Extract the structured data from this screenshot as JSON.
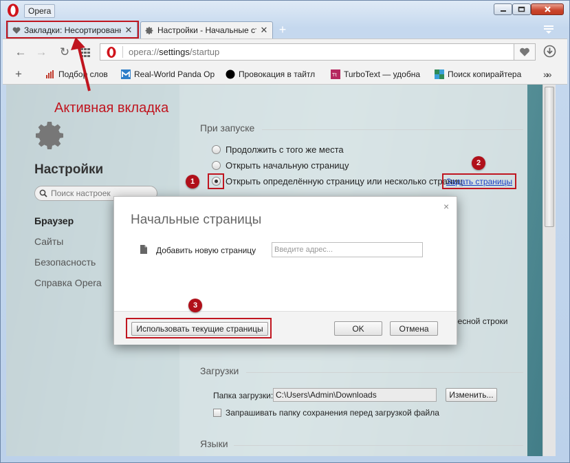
{
  "window": {
    "app_title": "Opera",
    "minimize_glyph": "—",
    "close_glyph": "✕"
  },
  "tabs": [
    {
      "label": "Закладки: Несортированные закладки",
      "icon": "heart-icon",
      "close": "✕"
    },
    {
      "label": "Настройки - Начальные страницы",
      "icon": "gear-icon",
      "close": "✕"
    }
  ],
  "new_tab_glyph": "+",
  "toolbar": {
    "back_glyph": "←",
    "forward_glyph": "→",
    "reload_glyph": "↻",
    "url_scheme": "opera://",
    "url_host": "settings",
    "url_path": "/startup"
  },
  "bookmarks_bar": {
    "add_glyph": "+",
    "more_glyph": "»»",
    "items": [
      {
        "label": "Подбор слов",
        "icon": "bar-chart-icon",
        "color": "#c0392b"
      },
      {
        "label": "Real-World Panda Op",
        "icon": "m-logo-icon",
        "color": "#2d7ec9"
      },
      {
        "label": "Провокация в тайтл",
        "icon": "black-circle-icon",
        "color": "#000000"
      },
      {
        "label": "TurboText — удобна",
        "icon": "tt-logo-icon",
        "color": "#b5275f"
      },
      {
        "label": "Поиск копирайтера",
        "icon": "grid-logo-icon",
        "color": "#2e8b57"
      }
    ]
  },
  "sidebar": {
    "title": "Настройки",
    "search_placeholder": "Поиск настроек",
    "items": [
      {
        "label": "Браузер",
        "active": true
      },
      {
        "label": "Сайты",
        "active": false
      },
      {
        "label": "Безопасность",
        "active": false
      },
      {
        "label": "Справка Opera",
        "active": false
      }
    ]
  },
  "startup": {
    "section_title": "При запуске",
    "options": [
      {
        "label": "Продолжить с того же места",
        "checked": false
      },
      {
        "label": "Открыть начальную страницу",
        "checked": false
      },
      {
        "label": "Открыть определённую страницу или несколько страниц",
        "checked": true
      }
    ],
    "set_pages_link": "Задать страницы",
    "address_bar_fragment": "дресной строки"
  },
  "downloads": {
    "section_title": "Загрузки",
    "folder_label": "Папка загрузки:",
    "folder_value": "C:\\Users\\Admin\\Downloads",
    "change_button": "Изменить...",
    "ask_label": "Запрашивать папку сохранения перед загрузкой файла"
  },
  "languages": {
    "section_title": "Языки"
  },
  "modal": {
    "title": "Начальные страницы",
    "close_glyph": "×",
    "add_label": "Добавить новую страницу",
    "address_placeholder": "Введите адрес...",
    "use_current_button": "Использовать текущие страницы",
    "ok_button": "OK",
    "cancel_button": "Отмена"
  },
  "annotations": {
    "active_tab_note": "Активная вкладка",
    "badges": [
      "1",
      "2",
      "3"
    ],
    "highlight_color": "#c0151f"
  }
}
